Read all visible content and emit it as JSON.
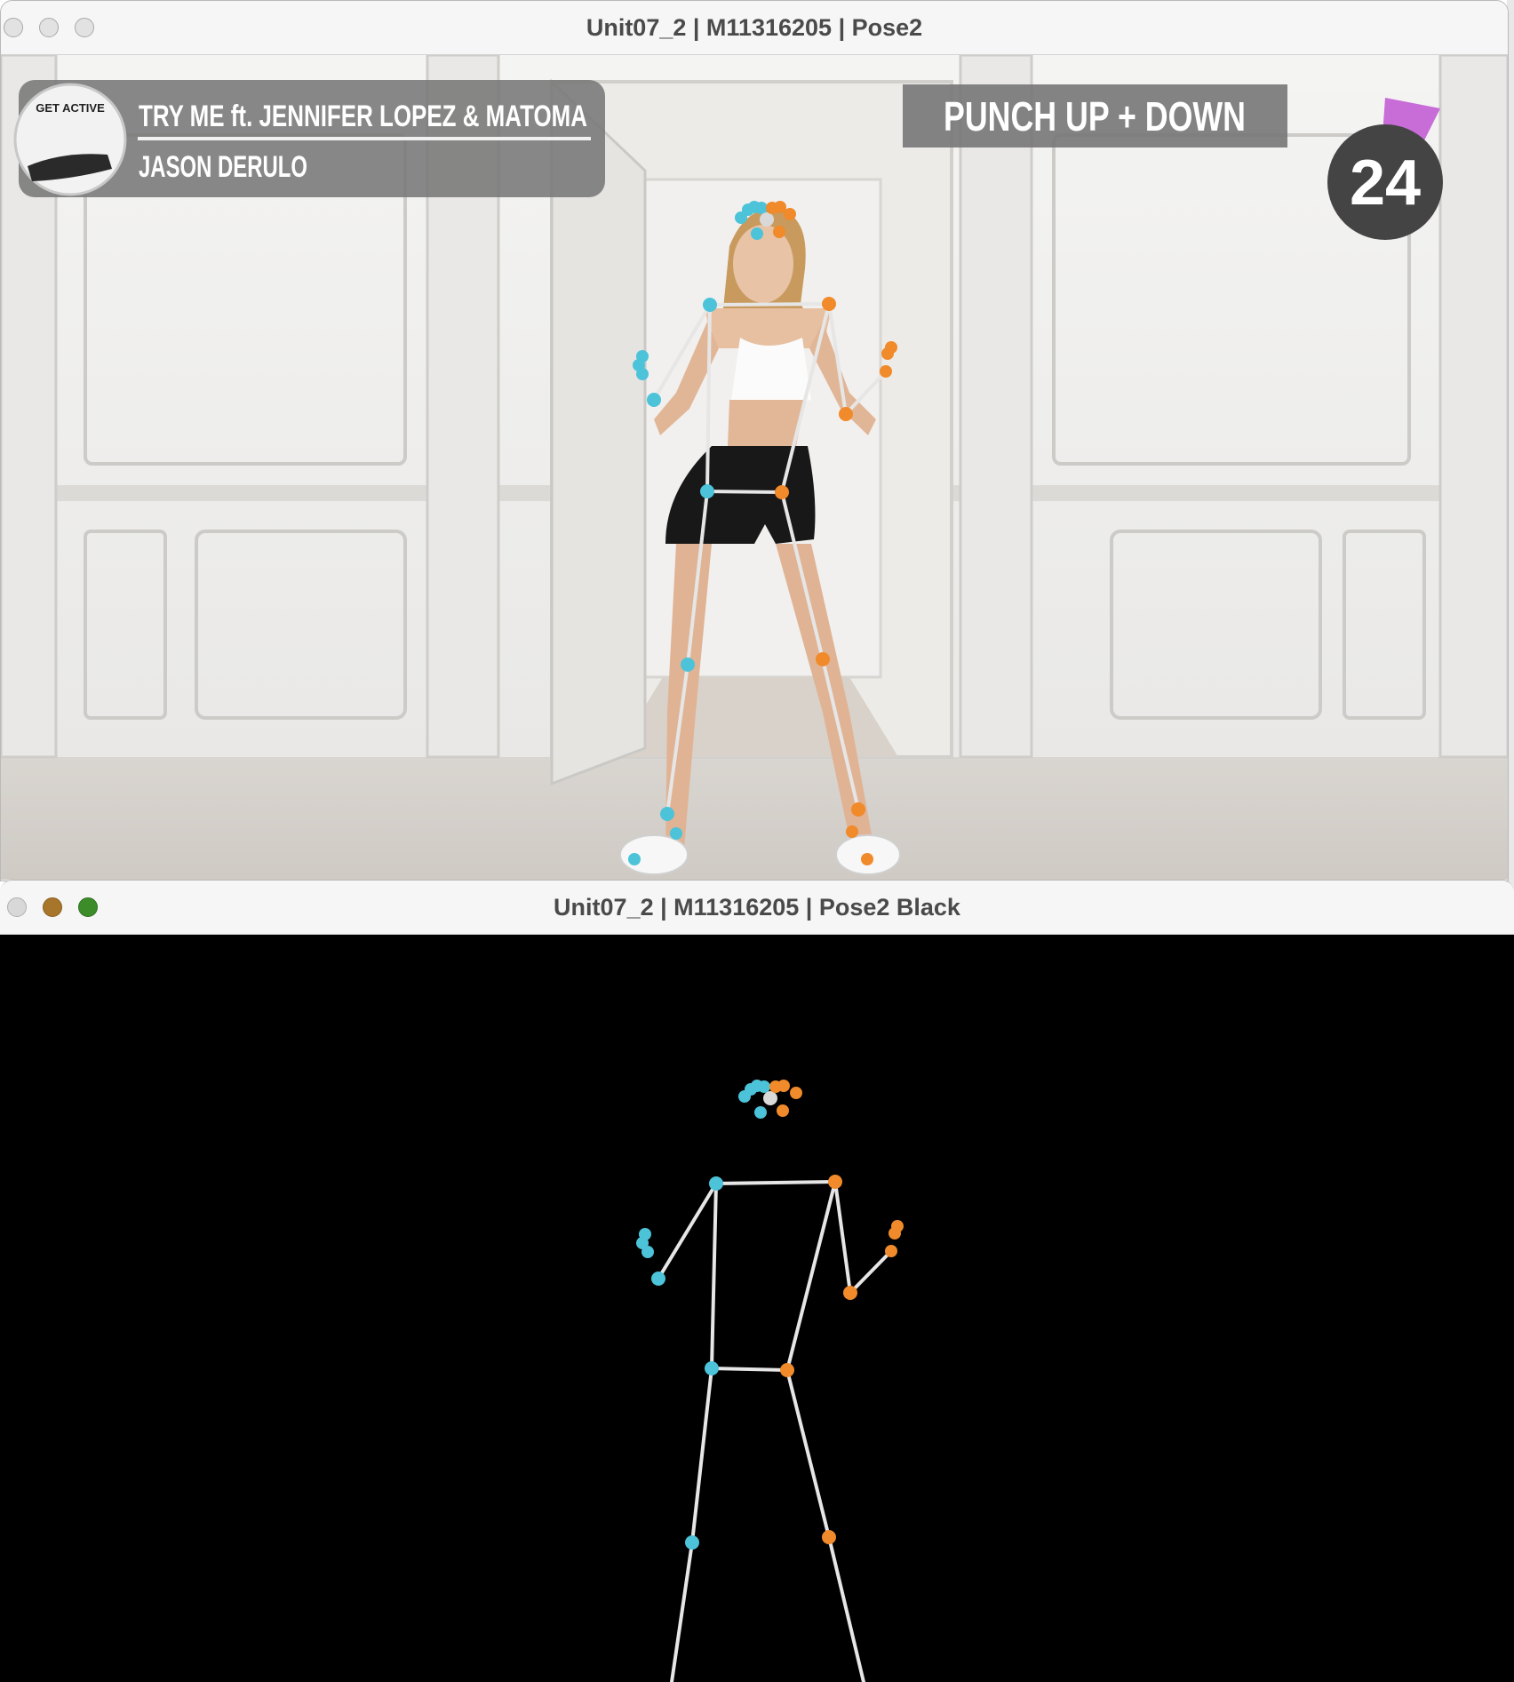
{
  "windows": [
    {
      "title": "Unit07_2 | M11316205 | Pose2",
      "traffic_lights": {
        "close": "#e2e2e2",
        "minimize": "#e2e2e2",
        "zoom": "#e2e2e2"
      },
      "video": {
        "badge_text": "GET ACTIVE",
        "song_title": "TRY ME ft. JENNIFER LOPEZ & MATOMA",
        "artist": "JASON DERULO",
        "exercise": "PUNCH UP + DOWN",
        "counter": "24"
      }
    },
    {
      "title": "Unit07_2 | M11316205 | Pose2 Black",
      "traffic_lights": {
        "close": "#d8d8d8",
        "minimize": "#a8762a",
        "zoom": "#3d8c2a"
      }
    }
  ],
  "colors": {
    "skeleton_line": "#e6e6e6",
    "left_joint": "#4cc3d9",
    "right_joint": "#f08a2a",
    "nose_joint": "#d9d9d9",
    "timer_accent": "#c86cd8"
  }
}
